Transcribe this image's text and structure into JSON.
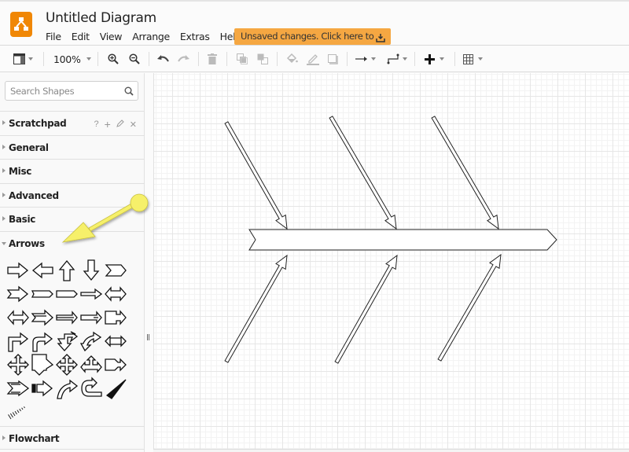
{
  "app": {
    "title": "Untitled Diagram",
    "logo": "drawio-logo-icon"
  },
  "menu": {
    "items": [
      "File",
      "Edit",
      "View",
      "Arrange",
      "Extras",
      "Help"
    ]
  },
  "notice": {
    "label": "Unsaved changes. Click here to save.",
    "icon": "download-icon",
    "color": "#f5a742"
  },
  "toolbar": {
    "zoom_level": "100%",
    "buttons": [
      {
        "name": "format-panel",
        "icon": "panel-layout-icon"
      },
      {
        "name": "zoom-in",
        "icon": "zoom-in-icon"
      },
      {
        "name": "zoom-out",
        "icon": "zoom-out-icon"
      },
      {
        "name": "undo",
        "icon": "undo-icon"
      },
      {
        "name": "redo",
        "icon": "redo-icon"
      },
      {
        "name": "delete",
        "icon": "trash-icon"
      },
      {
        "name": "to-front",
        "icon": "to-front-icon"
      },
      {
        "name": "to-back",
        "icon": "to-back-icon"
      },
      {
        "name": "fill-color",
        "icon": "fill-color-icon"
      },
      {
        "name": "line-color",
        "icon": "line-color-icon"
      },
      {
        "name": "shadow",
        "icon": "shadow-icon"
      },
      {
        "name": "connection",
        "icon": "connection-arrow-icon"
      },
      {
        "name": "waypoints",
        "icon": "waypoints-icon"
      },
      {
        "name": "insert",
        "icon": "plus-icon"
      },
      {
        "name": "table",
        "icon": "table-icon"
      }
    ]
  },
  "sidebar": {
    "search_placeholder": "Search Shapes",
    "search_value": "",
    "sections": [
      {
        "label": "Scratchpad",
        "expanded": false,
        "tools": [
          "?",
          "+",
          "✎",
          "✕"
        ]
      },
      {
        "label": "General",
        "expanded": false
      },
      {
        "label": "Misc",
        "expanded": false
      },
      {
        "label": "Advanced",
        "expanded": false
      },
      {
        "label": "Basic",
        "expanded": false
      },
      {
        "label": "Arrows",
        "expanded": true
      },
      {
        "label": "Flowchart",
        "expanded": false
      }
    ],
    "arrow_shapes": [
      "single-arrow-right",
      "single-arrow-left",
      "single-arrow-up",
      "single-arrow-down",
      "chevron",
      "notched-arrow",
      "callout-pentagon",
      "rounded-pentagon",
      "slim-arrow",
      "double-arrow",
      "double-arrow-wide",
      "striped-arrow",
      "long-arrow",
      "long-arrow-2",
      "callout-arrow",
      "bent-arrow",
      "bent-rounded-arrow",
      "bent-up-arrow",
      "curved-bent-arrow",
      "callout-double-arrow",
      "quad-arrow",
      "callout-quad",
      "quad-arrow-cross",
      "triple-arrow",
      "jump-arrow",
      "swallowtail-arrow",
      "striped-block-arrow",
      "curved-arrow",
      "u-turn-arrow",
      "triangle-wedge",
      "hatched-wedge"
    ]
  },
  "annotation": {
    "type": "callout-arrow",
    "color": "#f6f06a",
    "points_to": "Arrows"
  },
  "diagram": {
    "type": "fishbone",
    "spine": "notched-arrow-right",
    "bones": [
      {
        "position": "top",
        "index": 1
      },
      {
        "position": "top",
        "index": 2
      },
      {
        "position": "top",
        "index": 3
      },
      {
        "position": "bottom",
        "index": 1
      },
      {
        "position": "bottom",
        "index": 2
      },
      {
        "position": "bottom",
        "index": 3
      }
    ]
  }
}
